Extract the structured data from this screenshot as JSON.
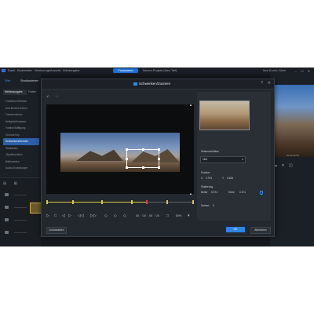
{
  "menubar": {
    "items": [
      "Datei",
      "Bearbeiten",
      "Werkzeuge",
      "Ansicht",
      "Wiedergabe"
    ],
    "center_button": "Produzieren",
    "project": "Neues Projekt (Neu Teil)",
    "account": "Ihre Konto: Mein",
    "window_controls": "– ☐ ✕"
  },
  "left_panel": {
    "tabs": [
      "Stile",
      "Strukturierten"
    ],
    "subtabs": [
      "Medienausgabe",
      "Farben"
    ],
    "items": [
      {
        "label": "Funktionen/Einfach",
        "selected": false
      },
      {
        "label": "Dritt-Bereich-Ebene",
        "selected": false
      },
      {
        "label": "Transformieren",
        "selected": false
      },
      {
        "label": "Helligkeit/Kontrast",
        "selected": false
      },
      {
        "label": "Farbton/Sättigung",
        "selected": false
      },
      {
        "label": "Chroma Key",
        "selected": false
      },
      {
        "label": "Schwenken/Zoomen",
        "selected": true
      },
      {
        "label": "Stabilisator",
        "selected": false
      },
      {
        "label": "Objektkorrektur",
        "selected": false
      },
      {
        "label": "Bildkorrektur",
        "selected": false
      },
      {
        "label": "Audio-Einstellungen",
        "selected": false
      }
    ]
  },
  "dialog": {
    "title": "Schwenken/Zoomen",
    "help": "?",
    "close": "✕",
    "undo_icon": "↶",
    "redo_icon": "↷",
    "scale_top": "▲",
    "scale_bottom": "▲",
    "reset_label": "Zurücksetzen",
    "ok_label": "OK",
    "cancel_label": "Abbrechen",
    "controls": {
      "play": "▷",
      "stop": "□",
      "prev": "◁",
      "next": "▷",
      "jump_start": "◁◁",
      "jump_end": "▷▷",
      "add_keyframe": "◇",
      "remove_keyframe": "◇",
      "copy_keyframe": "◇",
      "timecode": "00 : 00 : 05 : 05",
      "zoom": "50%",
      "zoom_chevron": "▾",
      "fit": "□"
    },
    "keyframes": [
      {
        "position": 0.0,
        "red": false
      },
      {
        "position": 0.18,
        "red": false
      },
      {
        "position": 0.38,
        "red": false
      },
      {
        "position": 0.58,
        "red": false
      },
      {
        "position": 0.68,
        "red": true
      },
      {
        "position": 0.82,
        "red": false
      },
      {
        "position": 1.0,
        "red": false
      }
    ],
    "progress": 0.68,
    "side": {
      "aspect_label": "Seitenverhältnis",
      "aspect_value": "16:9",
      "aspect_chevron": "▾",
      "position_label": "Position",
      "x_label": "X",
      "x_value": "0.793",
      "y_label": "Y",
      "y_value": "0.626",
      "scale_label": "Skalierung",
      "width_label": "Breite",
      "width_value": "0.371",
      "height_label": "Höhe",
      "height_value": "0.371",
      "rotation_label": "Drehen",
      "rotation_value": "0"
    }
  },
  "timeline_left": {
    "tools": "⊟ ⊞"
  },
  "right_panel": {
    "tools": "▬ ✕ ◫",
    "time": "00:00:25:00"
  },
  "colors": {
    "accent": "#2d86e6",
    "keyframe": "#d8c84a",
    "playhead": "#e14444"
  }
}
